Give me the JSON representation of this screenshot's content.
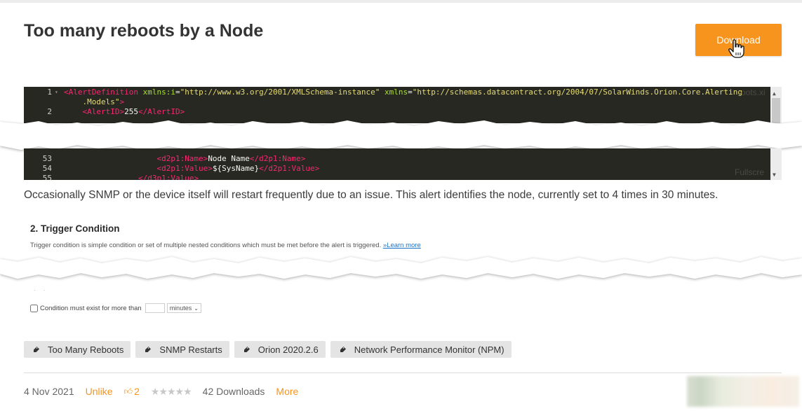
{
  "page": {
    "title": "Too many reboots by a Node",
    "download_label": "Download",
    "description": "Occasionally SNMP or the device itself will restart frequently due to an issue. This alert identifies the node, currently set to 4 times in 30 minutes."
  },
  "code": {
    "top_lines": [
      {
        "num": "1",
        "fold": "▾",
        "parts": [
          {
            "c": "tag",
            "t": "<AlertDefinition"
          },
          {
            "c": "attr",
            "t": " xmlns:i"
          },
          {
            "c": "plain",
            "t": "="
          },
          {
            "c": "str",
            "t": "\"http://www.w3.org/2001/XMLSchema-instance\""
          },
          {
            "c": "attr",
            "t": " xmlns"
          },
          {
            "c": "plain",
            "t": "="
          },
          {
            "c": "str",
            "t": "\"http://schemas.datacontract.org/2004/07/SolarWinds.Orion.Core.Alerting"
          }
        ]
      },
      {
        "num": "",
        "fold": "",
        "parts": [
          {
            "c": "str",
            "t": "    .Models\""
          },
          {
            "c": "tag",
            "t": ">"
          }
        ]
      },
      {
        "num": "2",
        "fold": "",
        "parts": [
          {
            "c": "plain",
            "t": "    "
          },
          {
            "c": "tag",
            "t": "<AlertID>"
          },
          {
            "c": "plain",
            "t": "255"
          },
          {
            "c": "tag",
            "t": "</AlertID>"
          }
        ]
      }
    ],
    "bottom_lines": [
      {
        "num": "53",
        "fold": "",
        "parts": [
          {
            "c": "plain",
            "t": "                    "
          },
          {
            "c": "tag",
            "t": "<d2p1:Name>"
          },
          {
            "c": "plain",
            "t": "Node Name"
          },
          {
            "c": "tag",
            "t": "</d2p1:Name>"
          }
        ]
      },
      {
        "num": "54",
        "fold": "",
        "parts": [
          {
            "c": "plain",
            "t": "                    "
          },
          {
            "c": "tag",
            "t": "<d2p1:Value>"
          },
          {
            "c": "plain",
            "t": "${SysName}"
          },
          {
            "c": "tag",
            "t": "</d2p1:Value>"
          }
        ]
      },
      {
        "num": "55",
        "fold": "",
        "parts": [
          {
            "c": "plain",
            "t": "                "
          },
          {
            "c": "tag",
            "t": "</d3p1:Value>"
          }
        ]
      }
    ],
    "fullscreen_label": "Fullscre"
  },
  "trigger": {
    "heading": "2. Trigger Condition",
    "text": "Trigger condition is simple condition or set of multiple nested conditions which must be met before the alert is triggered.",
    "learn_more": "»Learn more",
    "condition_label": "Condition must exist for more than",
    "unit_value": "minutes"
  },
  "tags": [
    {
      "label": "Too Many Reboots"
    },
    {
      "label": "SNMP Restarts"
    },
    {
      "label": "Orion 2020.2.6"
    },
    {
      "label": "Network Performance Monitor (NPM)"
    }
  ],
  "meta": {
    "date": "4 Nov 2021",
    "unlike": "Unlike",
    "likes": "2",
    "downloads": "42 Downloads",
    "more": "More",
    "rating_stars": 0
  },
  "colors": {
    "accent": "#f7941d",
    "code_bg": "#272822",
    "link": "#1a73c9"
  }
}
